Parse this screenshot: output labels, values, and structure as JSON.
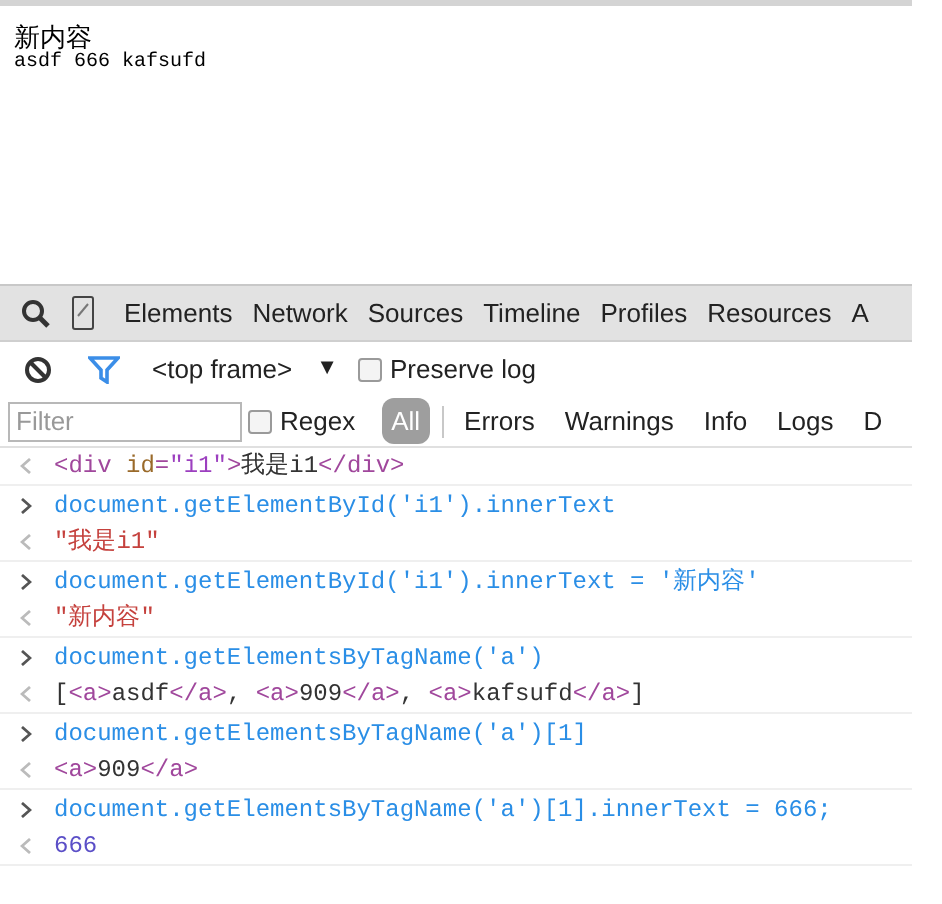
{
  "page": {
    "heading": "新内容",
    "line": "asdf 666 kafsufd"
  },
  "devtools": {
    "tabs": [
      "Elements",
      "Network",
      "Sources",
      "Timeline",
      "Profiles",
      "Resources",
      "A"
    ],
    "frame_select": "<top frame>",
    "frame_arrow": "▼",
    "preserve_log": {
      "label": "Preserve log",
      "checked": false
    },
    "filter": {
      "placeholder": "Filter"
    },
    "regex": {
      "label": "Regex",
      "checked": false
    },
    "levels": [
      {
        "label": "All",
        "selected": true
      },
      {
        "label": "Errors",
        "selected": false
      },
      {
        "label": "Warnings",
        "selected": false
      },
      {
        "label": "Info",
        "selected": false
      },
      {
        "label": "Logs",
        "selected": false
      },
      {
        "label": "D",
        "selected": false
      }
    ],
    "console": [
      {
        "kind": "output",
        "parts": [
          {
            "kind": "tag",
            "text": "<div"
          },
          {
            "kind": "attr",
            "text": " id"
          },
          {
            "kind": "tag",
            "text": "="
          },
          {
            "kind": "value",
            "text": "\"i1\""
          },
          {
            "kind": "tag",
            "text": ">"
          },
          {
            "kind": "text",
            "text": "我是i1"
          },
          {
            "kind": "tag",
            "text": "</div>"
          }
        ]
      },
      {
        "kind": "input",
        "parts": [
          {
            "kind": "code",
            "text": "document.getElementById('i1').innerText"
          }
        ]
      },
      {
        "kind": "output",
        "parts": [
          {
            "kind": "string",
            "text": "\"我是i1\""
          }
        ]
      },
      {
        "kind": "input",
        "parts": [
          {
            "kind": "code",
            "text": "document.getElementById('i1').innerText = '新内容'"
          }
        ]
      },
      {
        "kind": "output",
        "parts": [
          {
            "kind": "string",
            "text": "\"新内容\""
          }
        ]
      },
      {
        "kind": "input",
        "parts": [
          {
            "kind": "code",
            "text": "document.getElementsByTagName('a')"
          }
        ]
      },
      {
        "kind": "output",
        "parts": [
          {
            "kind": "text",
            "text": "["
          },
          {
            "kind": "tag",
            "text": "<a>"
          },
          {
            "kind": "text",
            "text": "asdf"
          },
          {
            "kind": "tag",
            "text": "</a>"
          },
          {
            "kind": "text",
            "text": ", "
          },
          {
            "kind": "tag",
            "text": "<a>"
          },
          {
            "kind": "text",
            "text": "909"
          },
          {
            "kind": "tag",
            "text": "</a>"
          },
          {
            "kind": "text",
            "text": ", "
          },
          {
            "kind": "tag",
            "text": "<a>"
          },
          {
            "kind": "text",
            "text": "kafsufd"
          },
          {
            "kind": "tag",
            "text": "</a>"
          },
          {
            "kind": "text",
            "text": "]"
          }
        ]
      },
      {
        "kind": "input",
        "parts": [
          {
            "kind": "code",
            "text": "document.getElementsByTagName('a')[1]"
          }
        ]
      },
      {
        "kind": "output",
        "parts": [
          {
            "kind": "tag",
            "text": "<a>"
          },
          {
            "kind": "text",
            "text": "909"
          },
          {
            "kind": "tag",
            "text": "</a>"
          }
        ]
      },
      {
        "kind": "input",
        "parts": [
          {
            "kind": "code",
            "text": "document.getElementsByTagName('a')[1].innerText = 666;"
          }
        ]
      },
      {
        "kind": "output",
        "parts": [
          {
            "kind": "number",
            "text": "666"
          }
        ]
      }
    ]
  }
}
